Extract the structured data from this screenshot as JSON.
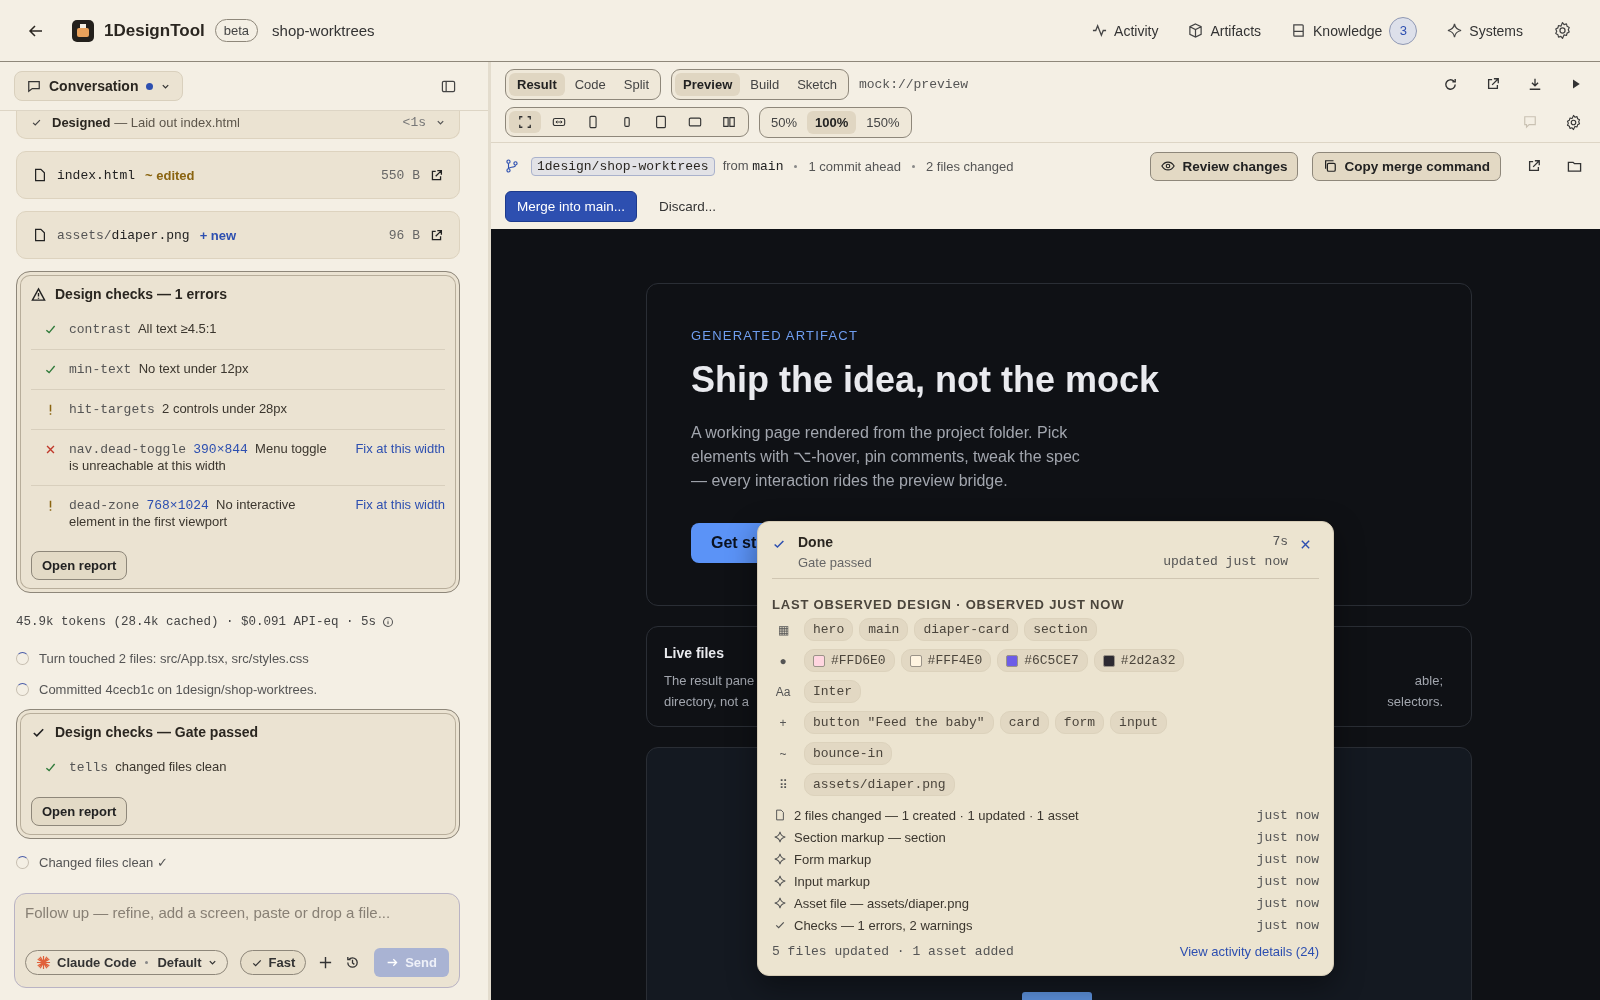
{
  "header": {
    "app_name": "1DesignTool",
    "badge": "beta",
    "project": "shop-worktrees",
    "nav": [
      {
        "kind": "activity",
        "label": "Activity"
      },
      {
        "kind": "artifacts",
        "label": "Artifacts"
      },
      {
        "kind": "knowledge",
        "label": "Knowledge",
        "count": "3"
      },
      {
        "kind": "systems",
        "label": "Systems"
      }
    ]
  },
  "conversation": {
    "title": "Conversation",
    "unread": true,
    "designed_row": {
      "title": "Designed",
      "text": "— Laid out index.html",
      "time": "<1s"
    },
    "files": [
      {
        "name_file": "index.html",
        "tag": "~ edited",
        "kind": "edited",
        "size": "550 B"
      },
      {
        "name_dir": "assets/",
        "name_file": "diaper.png",
        "tag": "+ new",
        "kind": "new",
        "size": "96 B"
      }
    ],
    "checks_errors": {
      "kind": "error",
      "title": "Design checks — 1 errors",
      "items": [
        {
          "kind": "pass",
          "name": "contrast",
          "text": "All text ≥4.5:1"
        },
        {
          "kind": "pass",
          "name": "min-text",
          "text": "No text under 12px"
        },
        {
          "kind": "warn",
          "name": "hit-targets",
          "text": "2 controls under 28px"
        },
        {
          "kind": "error",
          "name": "nav.dead-toggle",
          "size": "390×844",
          "text": "Menu toggle is unreachable at this width",
          "link": "Fix at this width"
        },
        {
          "kind": "warn",
          "name": "dead-zone",
          "size": "768×1024",
          "text": "No interactive element in the first viewport",
          "link": "Fix at this width"
        }
      ],
      "button": "Open report"
    },
    "usage": "45.9k tokens (28.4k cached) · $0.091 API-eq · 5s",
    "steps": [
      "Turn touched 2 files: src/App.tsx, src/styles.css",
      "Committed 4cecb1c on 1design/shop-worktrees."
    ],
    "checks_passed": {
      "kind": "passed",
      "title": "Design checks — Gate passed",
      "items": [
        {
          "kind": "pass",
          "name": "tells",
          "text": "changed files clean"
        }
      ],
      "button": "Open report"
    },
    "final_step": "Changed files clean ✓",
    "composer": {
      "placeholder": "Follow up — refine, add a screen, paste or drop a file...",
      "model": "Claude Code",
      "mode": "Default",
      "fast": "Fast",
      "fast_on": true,
      "send": "Send",
      "send_disabled": true
    }
  },
  "preview_toolbar": {
    "views": [
      {
        "label": "Result",
        "selected": true
      },
      {
        "label": "Code",
        "selected": false
      },
      {
        "label": "Split",
        "selected": false
      }
    ],
    "modes": [
      {
        "label": "Preview",
        "selected": true
      },
      {
        "label": "Build",
        "selected": false
      },
      {
        "label": "Sketch",
        "selected": false
      }
    ],
    "url": "mock://preview",
    "devices": [
      {
        "kind": "fit",
        "selected": true
      },
      {
        "kind": "width",
        "selected": false
      },
      {
        "kind": "phone",
        "selected": false
      },
      {
        "kind": "small",
        "selected": false
      },
      {
        "kind": "tablet",
        "selected": false
      },
      {
        "kind": "landscape",
        "selected": false
      },
      {
        "kind": "split",
        "selected": false
      }
    ],
    "zooms": [
      {
        "label": "50%",
        "selected": false
      },
      {
        "label": "100%",
        "selected": true
      },
      {
        "label": "150%",
        "selected": false
      }
    ]
  },
  "branch_bar": {
    "branch": "1design/shop-worktrees",
    "from": "from",
    "base": "main",
    "ahead": "1 commit ahead",
    "changed": "2 files changed",
    "review": "Review changes",
    "copy": "Copy merge command",
    "merge": "Merge into main...",
    "discard": "Discard..."
  },
  "preview": {
    "eyebrow": "GENERATED ARTIFACT",
    "title": "Ship the idea, not the mock",
    "text": "A working page rendered from the project folder. Pick elements with ⌥-hover, pin comments, tweak the spec — every interaction rides the preview bridge.",
    "cta": "Get st",
    "live_files": {
      "title": "Live files",
      "left_lines": [
        "The result pane",
        "directory, not a"
      ],
      "right_lines": [
        "able;",
        "selectors."
      ]
    }
  },
  "activity_popup": {
    "status": "Done",
    "subtitle": "Gate passed",
    "duration": "7s",
    "updated": "updated just now",
    "section_title": "LAST OBSERVED DESIGN · OBSERVED JUST NOW",
    "groups": [
      {
        "glyph": "▦",
        "chips": [
          {
            "label": "hero"
          },
          {
            "label": "main"
          },
          {
            "label": "diaper-card"
          },
          {
            "label": "section"
          }
        ]
      },
      {
        "glyph": "●",
        "chips": [
          {
            "label": "#FFD6E0",
            "color": "#ffd6e0"
          },
          {
            "label": "#FFF4E0",
            "color": "#fff4e0"
          },
          {
            "label": "#6C5CE7",
            "color": "#6c5ce7"
          },
          {
            "label": "#2d2a32",
            "color": "#2d2a32"
          }
        ]
      },
      {
        "glyph": "Aa",
        "chips": [
          {
            "label": "Inter"
          }
        ]
      },
      {
        "glyph": "+",
        "chips": [
          {
            "label": "button \"Feed the baby\""
          },
          {
            "label": "card"
          },
          {
            "label": "form"
          },
          {
            "label": "input"
          }
        ]
      },
      {
        "glyph": "~",
        "chips": [
          {
            "label": "bounce-in"
          }
        ]
      },
      {
        "glyph": "⠿",
        "chips": [
          {
            "label": "assets/diaper.png"
          }
        ]
      }
    ],
    "events": [
      {
        "kind": "file",
        "text": "2 files changed — 1 created · 1 updated · 1 asset",
        "time": "just now"
      },
      {
        "kind": "spark",
        "text": "Section markup — section",
        "time": "just now"
      },
      {
        "kind": "spark",
        "text": "Form markup",
        "time": "just now"
      },
      {
        "kind": "spark",
        "text": "Input markup",
        "time": "just now"
      },
      {
        "kind": "spark",
        "text": "Asset file — assets/diaper.png",
        "time": "just now"
      },
      {
        "kind": "check",
        "text": "Checks — 1 errors, 2 warnings",
        "time": "just now"
      }
    ],
    "summary": "5 files updated · 1 asset added",
    "link": "View activity details (24)"
  }
}
